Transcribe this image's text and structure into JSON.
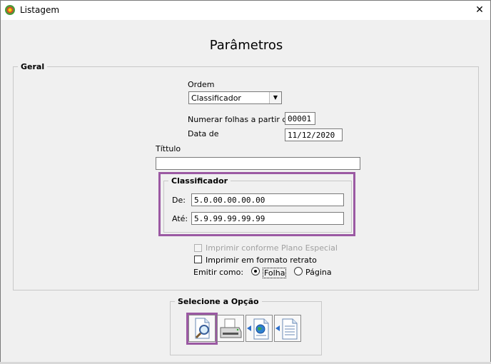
{
  "window": {
    "title": "Listagem",
    "close_symbol": "✕"
  },
  "header": {
    "title": "Parâmetros"
  },
  "geral": {
    "legend": "Geral",
    "ordem_label": "Ordem",
    "ordem_value": "Classificador",
    "numerar_label": "Numerar folhas a partir de:",
    "numerar_value": "00001",
    "data_label": "Data de",
    "data_value": "11/12/2020",
    "titulo_label": "Títtulo",
    "titulo_value": ""
  },
  "classificador": {
    "legend": "Classificador",
    "de_label": "De:",
    "de_value": "5.0.00.00.00.00",
    "ate_label": "Até:",
    "ate_value": "5.9.99.99.99.99"
  },
  "options": {
    "imprimir_plano": {
      "label": "Imprimir conforme Plano Especial",
      "checked": false,
      "disabled": true
    },
    "imprimir_retrato": {
      "label": "Imprimir em formato retrato",
      "checked": false
    },
    "emitir_label": "Emitir como:",
    "folha_label": "Folha",
    "pagina_label": "Página",
    "selected": "Folha"
  },
  "selecione": {
    "legend": "Selecione a Opção",
    "buttons": [
      "preview-icon",
      "printer-icon",
      "export-web-icon",
      "export-document-icon"
    ]
  },
  "colors": {
    "highlight": "#9b59a3"
  }
}
